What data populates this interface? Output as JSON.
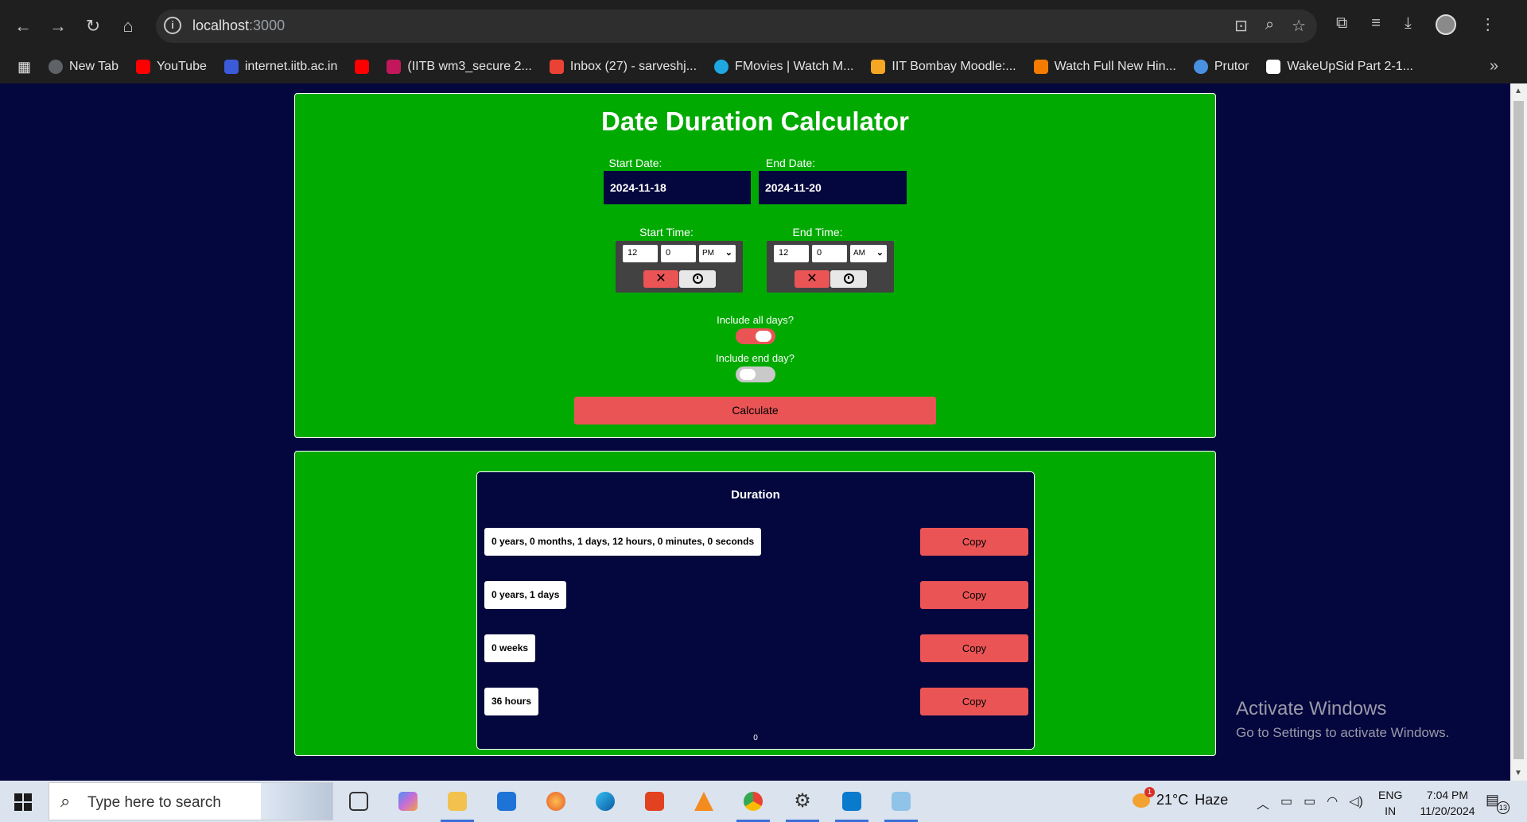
{
  "browser": {
    "url_host": "localhost",
    "url_port": ":3000",
    "bookmarks": [
      {
        "label": "New Tab",
        "color": "#5f6368"
      },
      {
        "label": "YouTube",
        "color": "#ff0000"
      },
      {
        "label": "internet.iitb.ac.in",
        "color": "#3b5bdb"
      },
      {
        "label": "",
        "color": "#ff0000"
      },
      {
        "label": "(IITB wm3_secure 2...",
        "color": "#c2185b"
      },
      {
        "label": "Inbox (27) - sarveshj...",
        "color": "#ea4335"
      },
      {
        "label": "FMovies | Watch M...",
        "color": "#1ea7e1"
      },
      {
        "label": "IIT Bombay Moodle:...",
        "color": "#f5a623"
      },
      {
        "label": "Watch Full New Hin...",
        "color": "#f57c00"
      },
      {
        "label": "Prutor",
        "color": "#4a90e2"
      },
      {
        "label": "WakeUpSid Part 2-1...",
        "color": "#ffffff"
      }
    ]
  },
  "app": {
    "title": "Date Duration Calculator",
    "start_date_label": "Start Date:",
    "start_date_value": "2024-11-18",
    "end_date_label": "End Date:",
    "end_date_value": "2024-11-20",
    "start_time_label": "Start Time:",
    "start_time": {
      "hour": "12",
      "minute": "0",
      "ampm": "PM"
    },
    "end_time_label": "End Time:",
    "end_time": {
      "hour": "12",
      "minute": "0",
      "ampm": "AM"
    },
    "include_all_days_label": "Include all days?",
    "include_all_days": true,
    "include_end_day_label": "Include end day?",
    "include_end_day": false,
    "calculate_label": "Calculate",
    "accent_color": "#ea5455",
    "panel_color": "#00aa00",
    "background_color": "#04063e"
  },
  "result": {
    "title": "Duration",
    "rows": [
      {
        "value": "0 years, 0 months, 1 days, 12 hours, 0 minutes, 0 seconds",
        "copy_label": "Copy"
      },
      {
        "value": "0 years, 1 days",
        "copy_label": "Copy"
      },
      {
        "value": "0 weeks",
        "copy_label": "Copy"
      },
      {
        "value": "36 hours",
        "copy_label": "Copy"
      }
    ],
    "footer": "0"
  },
  "watermark": {
    "line1": "Activate Windows",
    "line2": "Go to Settings to activate Windows."
  },
  "taskbar": {
    "search_placeholder": "Type here to search",
    "weather_temp": "21°C",
    "weather_desc": "Haze",
    "weather_badge": "1",
    "lang_line1": "ENG",
    "lang_line2": "IN",
    "time": "7:04 PM",
    "date": "11/20/2024",
    "notification_count": "13"
  }
}
